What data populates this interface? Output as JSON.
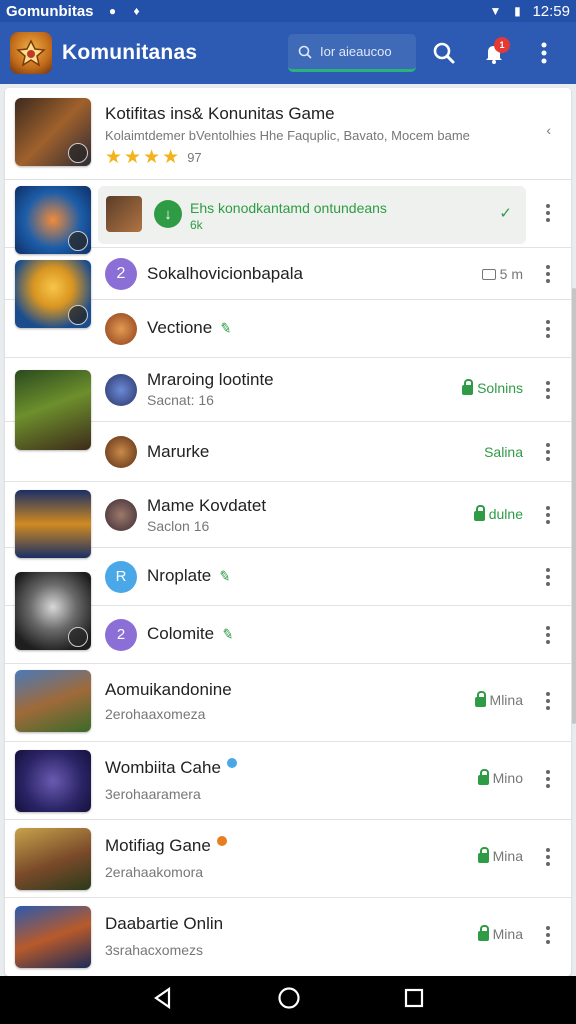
{
  "statusbar": {
    "title": "Gomunbitas",
    "time": "12:59"
  },
  "appbar": {
    "title": "Komunitanas",
    "search_placeholder": "Ior aieaucoo",
    "notification_count": "1"
  },
  "featured": {
    "title": "Kotifitas ins& Konunitas Game",
    "description": "Kolaimtdemer bVentolhies Hhe Faquplic, Bavato, Mocem bame",
    "rating_count": "97"
  },
  "download_banner": {
    "text": "Ehs konodkantamd ontundeans",
    "subtext": "6k"
  },
  "rows": [
    {
      "title": "Sokalhovicionbapala",
      "status": "5 m"
    },
    {
      "title": "Vectione"
    },
    {
      "title": "Mraroing lootinte",
      "subtitle": "Sacnat: 16",
      "status": "Solnins"
    },
    {
      "title": "Marurke",
      "status": "Salina"
    },
    {
      "title": "Mame Kovdatet",
      "subtitle": "Saclon 16",
      "status": "dulne"
    },
    {
      "title": "Nroplate"
    },
    {
      "title": "Colomite"
    },
    {
      "title": "Aomuikandonine",
      "subtitle": "2erohaaxomeza",
      "status": "Mlina"
    },
    {
      "title": "Wombiita Cahe",
      "subtitle": "3erohaaramera",
      "status": "Mino"
    },
    {
      "title": "Motifiag Gane",
      "subtitle": "2erahaakomora",
      "status": "Mina"
    },
    {
      "title": "Daabartie Onlin",
      "subtitle": "3srahacxomezs",
      "status": "Mina"
    }
  ],
  "colors": {
    "appbar": "#2d5bb4",
    "statusbar": "#2350a8",
    "accent_green": "#2f9c45",
    "star": "#f2b31d"
  }
}
